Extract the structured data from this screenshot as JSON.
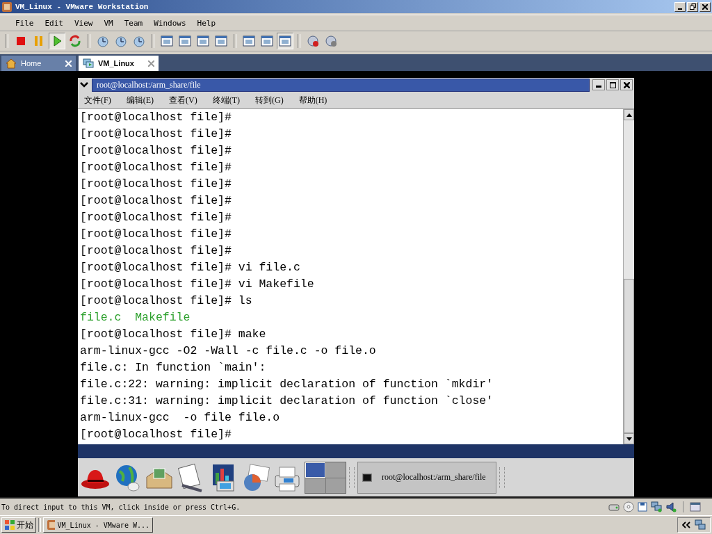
{
  "window": {
    "title": "VM_Linux - VMware Workstation"
  },
  "menu": [
    "File",
    "Edit",
    "View",
    "VM",
    "Team",
    "Windows",
    "Help"
  ],
  "toolbar_groups": [
    [
      {
        "pressed": false
      },
      {
        "pressed": false
      },
      {
        "pressed": true
      },
      {
        "pressed": false
      }
    ],
    [
      {
        "pressed": false
      },
      {
        "pressed": false
      },
      {
        "pressed": false
      }
    ],
    [
      {
        "pressed": false
      },
      {
        "pressed": false
      },
      {
        "pressed": false
      },
      {
        "pressed": false
      }
    ],
    [
      {
        "pressed": false
      },
      {
        "pressed": false
      },
      {
        "pressed": true
      }
    ],
    [
      {
        "pressed": false
      },
      {
        "pressed": false
      }
    ]
  ],
  "tabs": [
    {
      "label": "Home",
      "selected": false
    },
    {
      "label": "VM_Linux",
      "selected": true
    }
  ],
  "terminal": {
    "title": "root@localhost:/arm_share/file",
    "menu": [
      "文件(F)",
      "编辑(E)",
      "查看(V)",
      "终端(T)",
      "转到(G)",
      "帮助(H)"
    ],
    "lines": [
      {
        "kind": "prompt",
        "text": "[root@localhost file]#"
      },
      {
        "kind": "prompt",
        "text": "[root@localhost file]#"
      },
      {
        "kind": "prompt",
        "text": "[root@localhost file]#"
      },
      {
        "kind": "prompt",
        "text": "[root@localhost file]#"
      },
      {
        "kind": "prompt",
        "text": "[root@localhost file]#"
      },
      {
        "kind": "prompt",
        "text": "[root@localhost file]#"
      },
      {
        "kind": "prompt",
        "text": "[root@localhost file]#"
      },
      {
        "kind": "prompt",
        "text": "[root@localhost file]#"
      },
      {
        "kind": "prompt",
        "text": "[root@localhost file]#"
      },
      {
        "kind": "prompt",
        "text": "[root@localhost file]# vi file.c"
      },
      {
        "kind": "prompt",
        "text": "[root@localhost file]# vi Makefile"
      },
      {
        "kind": "prompt",
        "text": "[root@localhost file]# ls"
      },
      {
        "kind": "listing",
        "text": "file.c  Makefile"
      },
      {
        "kind": "prompt",
        "text": "[root@localhost file]# make"
      },
      {
        "kind": "output",
        "text": "arm-linux-gcc -O2 -Wall -c file.c -o file.o"
      },
      {
        "kind": "output",
        "text": "file.c: In function `main':"
      },
      {
        "kind": "output",
        "text": "file.c:22: warning: implicit declaration of function `mkdir'"
      },
      {
        "kind": "output",
        "text": "file.c:31: warning: implicit declaration of function `close'"
      },
      {
        "kind": "output",
        "text": "arm-linux-gcc  -o file file.o"
      },
      {
        "kind": "prompt",
        "text": "[root@localhost file]#"
      }
    ]
  },
  "panel": {
    "workspaces": [
      {
        "selected": true
      },
      {
        "selected": false
      },
      {
        "selected": false
      },
      {
        "selected": false
      }
    ],
    "task": "root@localhost:/arm_share/file"
  },
  "status_bar": {
    "text": "To direct input to this VM, click inside or press Ctrl+G."
  },
  "taskbar": {
    "start": "开始",
    "task": "VM_Linux - VMware W..."
  }
}
